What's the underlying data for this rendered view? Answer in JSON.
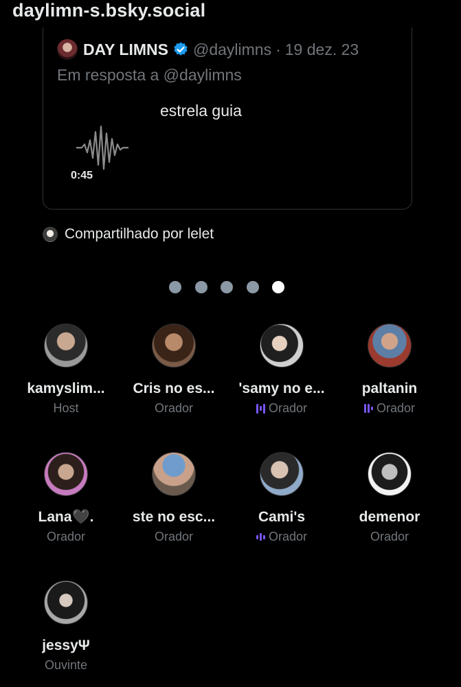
{
  "header": {
    "title": "daylimn-s.bsky.social"
  },
  "tweet": {
    "author": "DAY LIMNS",
    "handle": "@daylimns",
    "separator": "·",
    "date": "19 dez. 23",
    "reply_to": "Em resposta a @daylimns",
    "audio_title": "estrela guia",
    "audio_duration": "0:45",
    "verified_color": "#1d9bf0"
  },
  "shared_by": {
    "text": "Compartilhado por lelet"
  },
  "pager": {
    "count": 5,
    "active_index": 4
  },
  "accent_color": "#7856ff",
  "members": [
    {
      "name": "kamyslim...",
      "role": "Host",
      "speaking": false
    },
    {
      "name": "Cris no es...",
      "role": "Orador",
      "speaking": false
    },
    {
      "name": "ʹsamy no e...",
      "role": "Orador",
      "speaking": true
    },
    {
      "name": "paltanin",
      "role": "Orador",
      "speaking": true
    },
    {
      "name": "Lana🖤.",
      "role": "Orador",
      "speaking": false
    },
    {
      "name": "ste no esc...",
      "role": "Orador",
      "speaking": false
    },
    {
      "name": "Cami's",
      "role": "Orador",
      "speaking": true
    },
    {
      "name": "demenor",
      "role": "Orador",
      "speaking": false
    },
    {
      "name": "jessyΨ",
      "role": "Ouvinte",
      "speaking": false
    }
  ]
}
